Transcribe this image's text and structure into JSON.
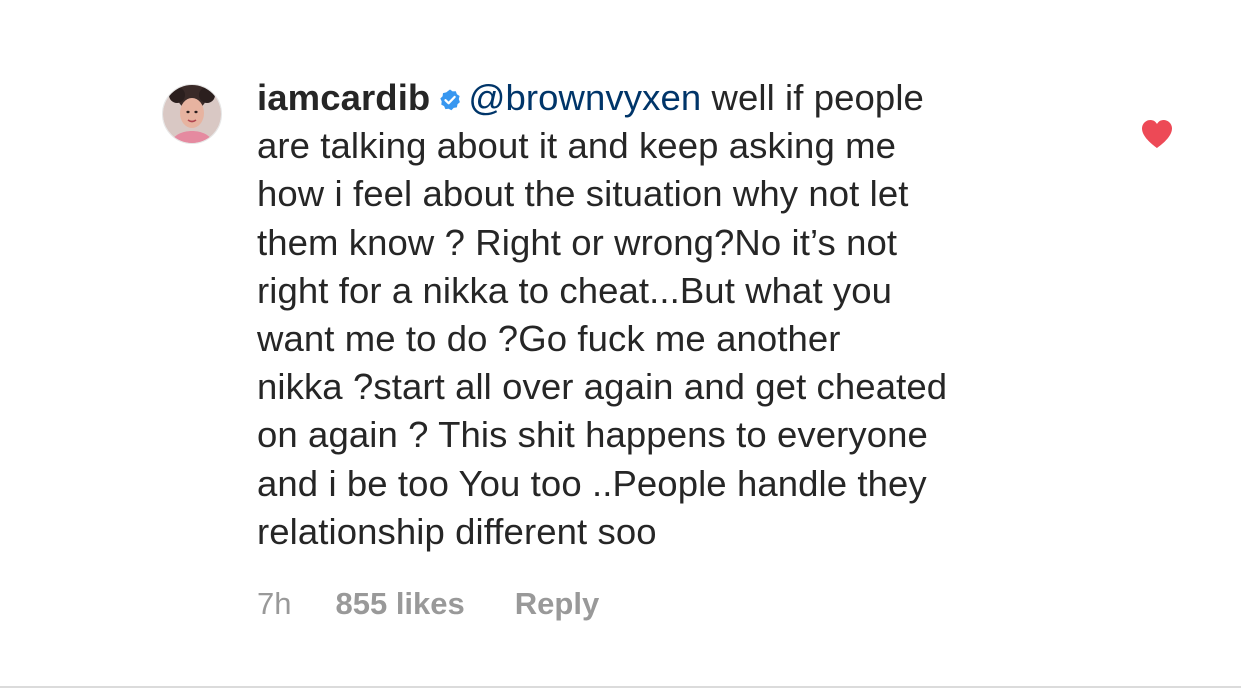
{
  "comment": {
    "username": "iamcardib",
    "verified": true,
    "mention": "@brownvyxen",
    "lines": [
      " well if people",
      "are talking about it and keep asking me",
      "how i feel about the situation why not let",
      "them know ? Right or wrong?No it’s not",
      "right for a nikka to cheat...But what you",
      "want me to do ?Go fuck me another",
      "nikka ?start all over again and get cheated",
      "on again ? This shit happens to everyone",
      "and i be too You too ..People handle they",
      "relationship different soo"
    ],
    "time": "7h",
    "likes": "855 likes",
    "reply_label": "Reply",
    "liked": true,
    "icons": {
      "verified": "verified-badge-icon",
      "like": "heart-icon",
      "avatar": "avatar"
    },
    "colors": {
      "text": "#262626",
      "mention": "#003569",
      "meta": "#999999",
      "verified": "#3897f0",
      "heart": "#ed4956"
    }
  }
}
